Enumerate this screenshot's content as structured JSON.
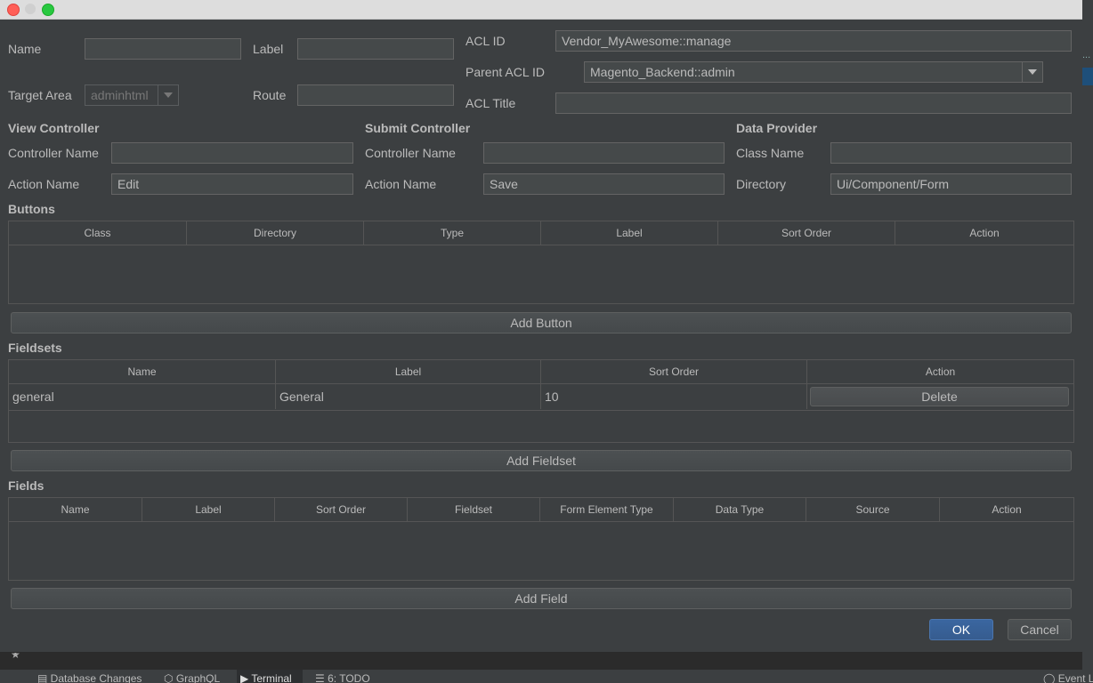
{
  "colors": {
    "dialog_bg": "#3c3f41",
    "field_bg": "#45494a",
    "primary": "#365c8f",
    "title_bar": "#dddddd",
    "close": "#ff5f57",
    "minimize": "#febc2e",
    "zoom": "#28c840"
  },
  "form": {
    "name_label": "Name",
    "name_value": "",
    "label_label": "Label",
    "label_value": "",
    "target_area_label": "Target Area",
    "target_area_value": "adminhtml",
    "route_label": "Route",
    "route_value": "",
    "acl_id_label": "ACL ID",
    "acl_id_value": "Vendor_MyAwesome::manage",
    "parent_acl_id_label": "Parent ACL ID",
    "parent_acl_id_value": "Magento_Backend::admin",
    "acl_title_label": "ACL Title",
    "acl_title_value": ""
  },
  "view_controller": {
    "title": "View Controller",
    "controller_name_label": "Controller Name",
    "controller_name_value": "",
    "action_name_label": "Action Name",
    "action_name_value": "Edit"
  },
  "submit_controller": {
    "title": "Submit Controller",
    "controller_name_label": "Controller Name",
    "controller_name_value": "",
    "action_name_label": "Action Name",
    "action_name_value": "Save"
  },
  "data_provider": {
    "title": "Data Provider",
    "class_name_label": "Class Name",
    "class_name_value": "",
    "directory_label": "Directory",
    "directory_value": "Ui/Component/Form"
  },
  "buttons": {
    "title": "Buttons",
    "columns": [
      "Class",
      "Directory",
      "Type",
      "Label",
      "Sort Order",
      "Action"
    ],
    "add_label": "Add Button"
  },
  "fieldsets": {
    "title": "Fieldsets",
    "columns": [
      "Name",
      "Label",
      "Sort Order",
      "Action"
    ],
    "rows": [
      {
        "name": "general",
        "label": "General",
        "sort_order": "10",
        "action": "Delete"
      }
    ],
    "add_label": "Add Fieldset"
  },
  "fields": {
    "title": "Fields",
    "columns": [
      "Name",
      "Label",
      "Sort Order",
      "Fieldset",
      "Form Element Type",
      "Data Type",
      "Source",
      "Action"
    ],
    "add_label": "Add Field"
  },
  "footer": {
    "ok_label": "OK",
    "cancel_label": "Cancel"
  },
  "ide_tabs": [
    {
      "label": "Database Changes",
      "icon": "database-icon"
    },
    {
      "label": "GraphQL",
      "icon": "graphql-icon"
    },
    {
      "label": "Terminal",
      "icon": "terminal-icon"
    },
    {
      "label": "6: TODO",
      "icon": "todo-list-icon"
    },
    {
      "label": "Event L",
      "icon": "event-log-icon"
    }
  ]
}
